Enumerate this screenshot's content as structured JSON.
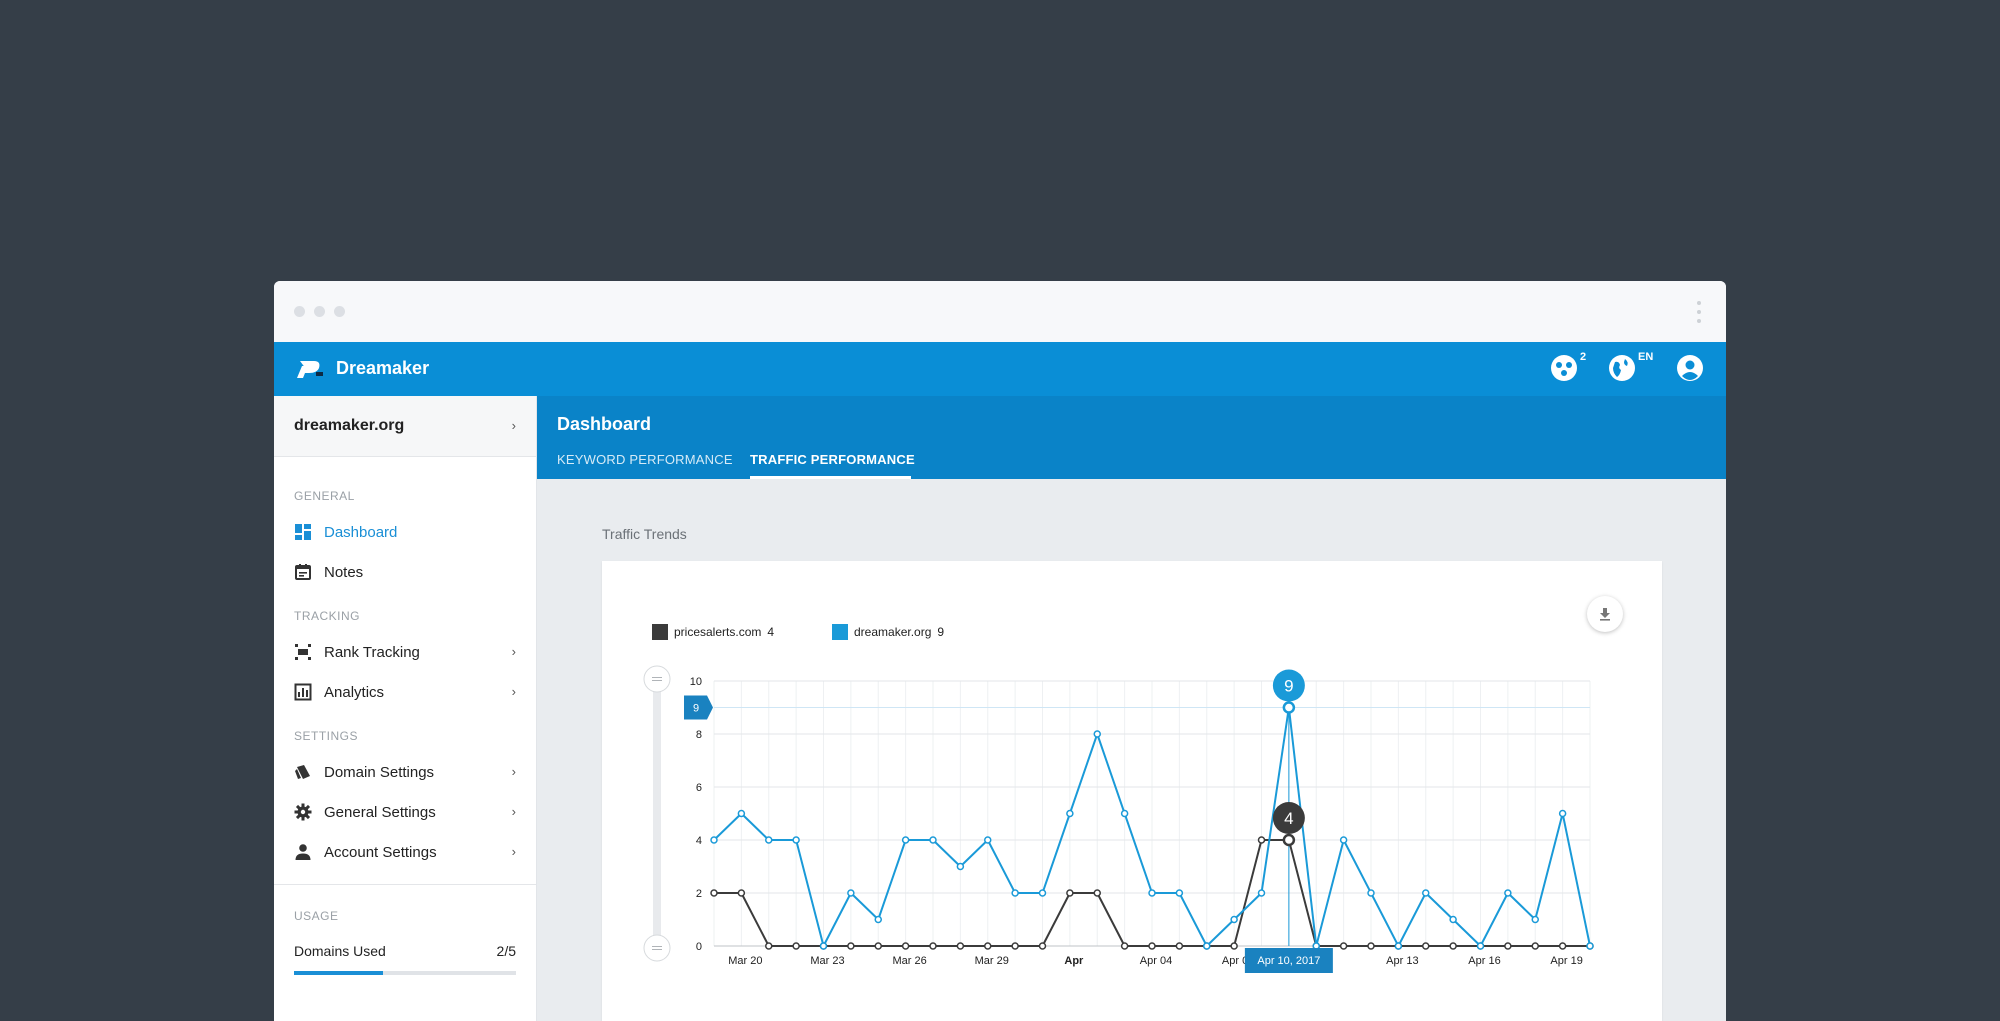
{
  "app": {
    "brand": "Dreamaker"
  },
  "topbar": {
    "notifications_count": "2",
    "language": "EN"
  },
  "sidebar": {
    "domain": "dreamaker.org",
    "sections": {
      "general": "GENERAL",
      "tracking": "TRACKING",
      "settings": "SETTINGS",
      "usage": "USAGE"
    },
    "items": [
      {
        "label": "Dashboard",
        "icon": "dashboard-icon",
        "active": true
      },
      {
        "label": "Notes",
        "icon": "calendar-icon"
      },
      {
        "label": "Rank Tracking",
        "icon": "rank-tracking-icon"
      },
      {
        "label": "Analytics",
        "icon": "analytics-icon"
      },
      {
        "label": "Domain Settings",
        "icon": "domain-icon"
      },
      {
        "label": "General Settings",
        "icon": "gear-icon"
      },
      {
        "label": "Account Settings",
        "icon": "person-icon"
      }
    ],
    "usage": {
      "label": "Domains Used",
      "value": "2/5",
      "fraction": 0.4
    }
  },
  "main": {
    "title": "Dashboard",
    "tabs": [
      {
        "label": "KEYWORD PERFORMANCE"
      },
      {
        "label": "TRAFFIC PERFORMANCE",
        "active": true
      }
    ],
    "section_title": "Traffic Trends"
  },
  "colors": {
    "accent": "#0a8ed6",
    "series_dark": "#3b3b3b",
    "series_blue": "#1a9ad8"
  },
  "chart_data": {
    "type": "line",
    "legend": [
      {
        "name": "pricesalerts.com",
        "value": "4"
      },
      {
        "name": "dreamaker.org",
        "value": "9"
      }
    ],
    "x": [
      "Mar 19",
      "Mar 20",
      "Mar 21",
      "Mar 22",
      "Mar 23",
      "Mar 24",
      "Mar 25",
      "Mar 26",
      "Mar 27",
      "Mar 28",
      "Mar 29",
      "Mar 30",
      "Mar 31",
      "Apr 01",
      "Apr 02",
      "Apr 03",
      "Apr 04",
      "Apr 05",
      "Apr 06",
      "Apr 07",
      "Apr 08",
      "Apr 09",
      "Apr 10",
      "Apr 11",
      "Apr 12",
      "Apr 13",
      "Apr 14",
      "Apr 15",
      "Apr 16",
      "Apr 17",
      "Apr 18",
      "Apr 19",
      "Apr 20"
    ],
    "x_tick_labels": [
      "Mar 20",
      "Mar 23",
      "Mar 26",
      "Mar 29",
      "Apr",
      "Apr 04",
      "Apr 07",
      "Apr 13",
      "Apr 16",
      "Apr 19"
    ],
    "x_tick_dates": [
      "Mar 20",
      "Mar 23",
      "Mar 26",
      "Mar 29",
      "Apr 01",
      "Apr 04",
      "Apr 07",
      "Apr 13",
      "Apr 16",
      "Apr 19"
    ],
    "series": [
      {
        "name": "pricesalerts.com",
        "color": "#3b3b3b",
        "values": [
          2,
          2,
          0,
          0,
          0,
          0,
          0,
          0,
          0,
          0,
          0,
          0,
          0,
          2,
          2,
          0,
          0,
          0,
          0,
          0,
          4,
          4,
          0,
          0,
          0,
          0,
          0,
          0,
          0,
          0,
          0,
          0,
          0
        ]
      },
      {
        "name": "dreamaker.org",
        "color": "#1a9ad8",
        "values": [
          4,
          5,
          4,
          4,
          0,
          2,
          1,
          4,
          4,
          3,
          4,
          2,
          2,
          5,
          8,
          5,
          2,
          2,
          0,
          1,
          2,
          9,
          0,
          4,
          2,
          0,
          2,
          1,
          0,
          2,
          1,
          5,
          0
        ]
      }
    ],
    "ylim": [
      0,
      10
    ],
    "y_ticks": [
      0,
      2,
      4,
      6,
      8,
      10
    ],
    "highlight": {
      "date_label": "Apr 10, 2017",
      "blue_value": "9",
      "dark_value": "4",
      "y_marker": "9",
      "index": 21
    },
    "grid": true
  }
}
